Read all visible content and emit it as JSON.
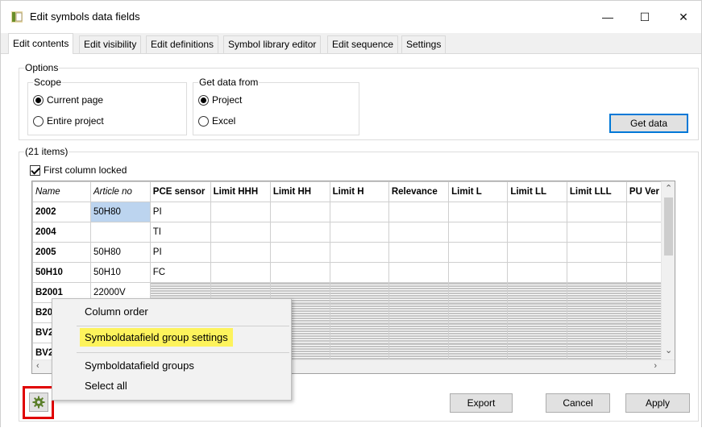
{
  "window": {
    "title": "Edit symbols data fields",
    "minimize": "—",
    "maximize": "☐",
    "close": "✕"
  },
  "tabs": [
    "Edit contents",
    "Edit visibility",
    "Edit definitions",
    "Symbol library editor",
    "Edit sequence",
    "Settings"
  ],
  "options": {
    "label": "Options",
    "scope": {
      "label": "Scope",
      "items": [
        "Current page",
        "Entire project"
      ],
      "selected": "Current page"
    },
    "get_data_from": {
      "label": "Get data from",
      "items": [
        "Project",
        "Excel"
      ],
      "selected": "Project"
    },
    "get_data_button": "Get data"
  },
  "items_group": {
    "label": "(21 items)",
    "first_column_locked": "First column locked"
  },
  "grid": {
    "columns": [
      "Name",
      "Article no",
      "PCE sensor",
      "Limit HHH",
      "Limit HH",
      "Limit H",
      "Relevance",
      "Limit L",
      "Limit LL",
      "Limit LLL",
      "PU Ver"
    ],
    "rows": [
      [
        "2002",
        "50H80",
        "PI"
      ],
      [
        "2004",
        "",
        "TI"
      ],
      [
        "2005",
        "50H80",
        "PI"
      ],
      [
        "50H10",
        "50H10",
        "FC"
      ],
      [
        "B2001",
        "22000V",
        ""
      ],
      [
        "B20",
        "",
        ""
      ],
      [
        "BV2",
        "",
        ""
      ],
      [
        "BV2",
        "",
        ""
      ]
    ]
  },
  "context_menu": {
    "items": [
      "Column order",
      "Symboldatafield group settings",
      "Symboldatafield groups",
      "Select all"
    ],
    "highlighted": "Symboldatafield group settings",
    "highlight_color": "#fdf35c"
  },
  "footer": {
    "export": "Export",
    "cancel": "Cancel",
    "apply": "Apply"
  },
  "colors": {
    "accent": "#0078d7",
    "selection": "#bcd4ef",
    "annotation_box": "#e00000"
  }
}
